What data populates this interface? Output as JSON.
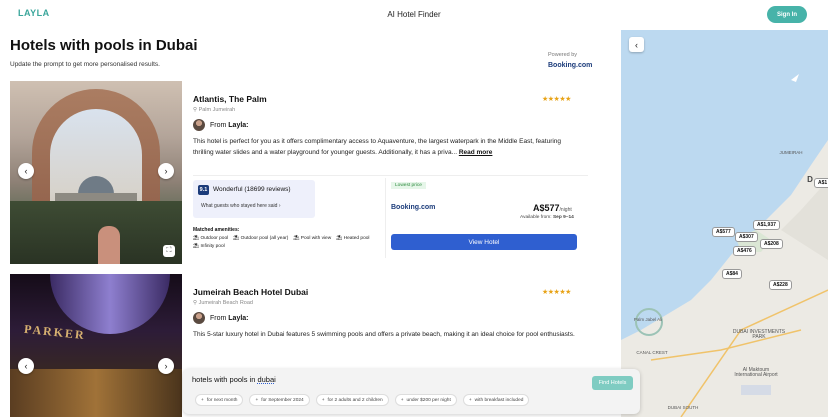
{
  "header": {
    "logo": "LAYLA",
    "title": "AI Hotel Finder",
    "signin": "Sign In"
  },
  "page": {
    "title": "Hotels with pools in Dubai",
    "subtitle": "Update the prompt to get more personalised results.",
    "powered_by": "Powered by",
    "provider": "Booking.com"
  },
  "hotels": [
    {
      "name": "Atlantis, The Palm",
      "stars": "★★★★★",
      "location": "Palm Jumeirah",
      "from_prefix": "From ",
      "from_name": "Layla:",
      "description": "This hotel is perfect for you as it offers complimentary access to Aquaventure, the largest waterpark in the Middle East, featuring thrilling water slides and a water playground for younger guests. Additionally, it has a priva...",
      "read_more": "Read more",
      "score": "9.1",
      "rating": "Wonderful (18699 reviews)",
      "guests_said": "What guests who stayed here said ›",
      "amenities_label": "Matched amenities:",
      "amenities": [
        "Outdoor pool",
        "Outdoor pool (all year)",
        "Pool with view",
        "Heated pool",
        "Infinity pool"
      ],
      "lowest_price": "Lowest price",
      "provider": "Booking.com",
      "price": "A$577",
      "per_night": "/night",
      "available_from": "Available from: ",
      "dates": "Sep 9–14",
      "view": "View Hotel"
    },
    {
      "name": "Jumeirah Beach Hotel Dubai",
      "stars": "★★★★★",
      "location": "Jumeirah Beach Road",
      "from_prefix": "From ",
      "from_name": "Layla:",
      "description": "This 5-star luxury hotel in Dubai features 5 swimming pools and offers a private beach, making it an ideal choice for pool enthusiasts."
    }
  ],
  "prompt": {
    "text": "hotels with pools in ",
    "highlight": "dubai",
    "button": "Find Hotels",
    "chips": [
      "for next month",
      "for September 2024",
      "for 2 adults and 2 children",
      "under $200 per night",
      "with breakfast included"
    ]
  },
  "map": {
    "pins": [
      "A$1,937",
      "A$577",
      "A$307",
      "A$208",
      "A$476",
      "A$84",
      "A$228",
      "A$1"
    ],
    "labels": {
      "palm": "Palm Jabel Ali",
      "canal": "CANAL CREST",
      "dubai_investments": "DUBAI INVESTMENTS PARK",
      "airport": "Al Maktoum International Airport",
      "south": "DUBAI SOUTH",
      "jumeirah": "JUMEIRAH",
      "d": "D"
    },
    "colors": {
      "water": "#bcd9f0",
      "land": "#eceae4",
      "pin_border": "#999999"
    }
  },
  "colors": {
    "accent": "#47b3a9",
    "primary": "#2f5fd0",
    "booking": "#1b3b7a",
    "stars": "#e8a317"
  }
}
